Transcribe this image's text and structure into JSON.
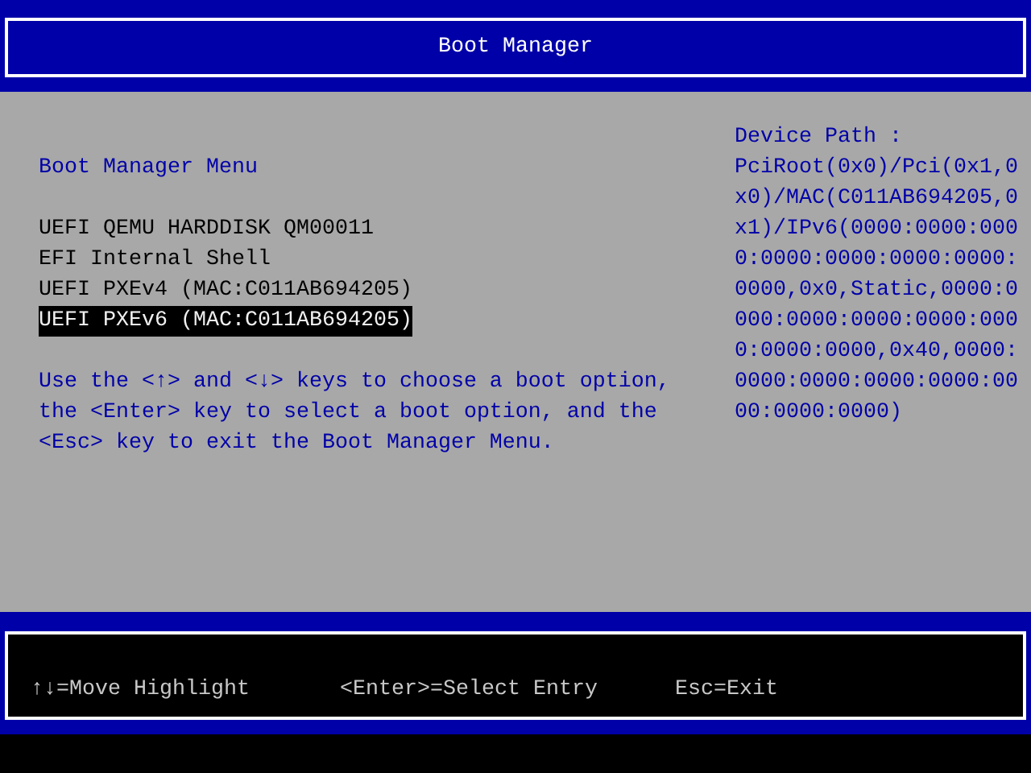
{
  "title": "Boot Manager",
  "menu_heading": "Boot Manager Menu",
  "boot_options": [
    {
      "label": "UEFI QEMU HARDDISK QM00011",
      "selected": false
    },
    {
      "label": "EFI Internal Shell",
      "selected": false
    },
    {
      "label": "UEFI PXEv4 (MAC:C011AB694205)",
      "selected": false
    },
    {
      "label": "UEFI PXEv6 (MAC:C011AB694205)",
      "selected": true
    }
  ],
  "help_text": "Use the <↑> and <↓> keys to choose a boot option, the <Enter> key to select a boot option, and the <Esc> key to exit the Boot Manager Menu.",
  "device_path": {
    "label": "Device Path :",
    "value": "PciRoot(0x0)/Pci(0x1,0x0)/MAC(C011AB694205,0x1)/IPv6(0000:0000:0000:0000:0000:0000:0000:0000,0x0,Static,0000:0000:0000:0000:0000:0000:0000:0000,0x40,0000:0000:0000:0000:0000:0000:0000:0000)"
  },
  "footer_hints": [
    "↑↓=Move Highlight",
    "<Enter>=Select Entry",
    "Esc=Exit"
  ]
}
